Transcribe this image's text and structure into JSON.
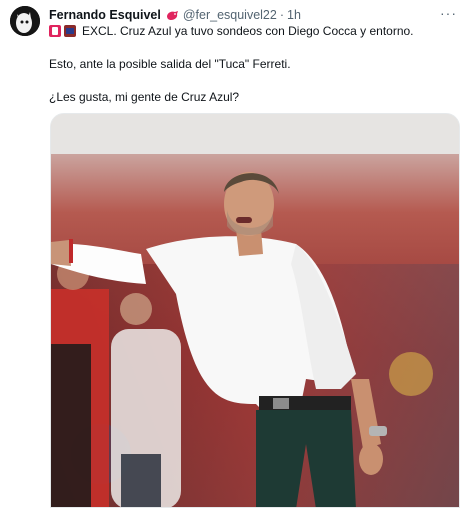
{
  "tweet": {
    "author": {
      "display_name": "Fernando Esquivel",
      "handle": "@fer_esquivel22",
      "separator": "·",
      "time": "1h",
      "badge_icon": "red-bird-badge"
    },
    "more_label": "···",
    "text": {
      "line1": "EXCL. Cruz Azul ya tuvo sondeos con Diego Cocca y entorno.",
      "line2": "Esto, ante la posible salida del \"Tuca\" Ferreti.",
      "line3": "¿Les gusta, mi gente de Cruz Azul?"
    },
    "emoji_icons": [
      "red-flag-emoji",
      "stadium-emoji"
    ],
    "colors": {
      "text": "#0f1419",
      "secondary": "#536471",
      "badge": "#e0245e"
    }
  }
}
